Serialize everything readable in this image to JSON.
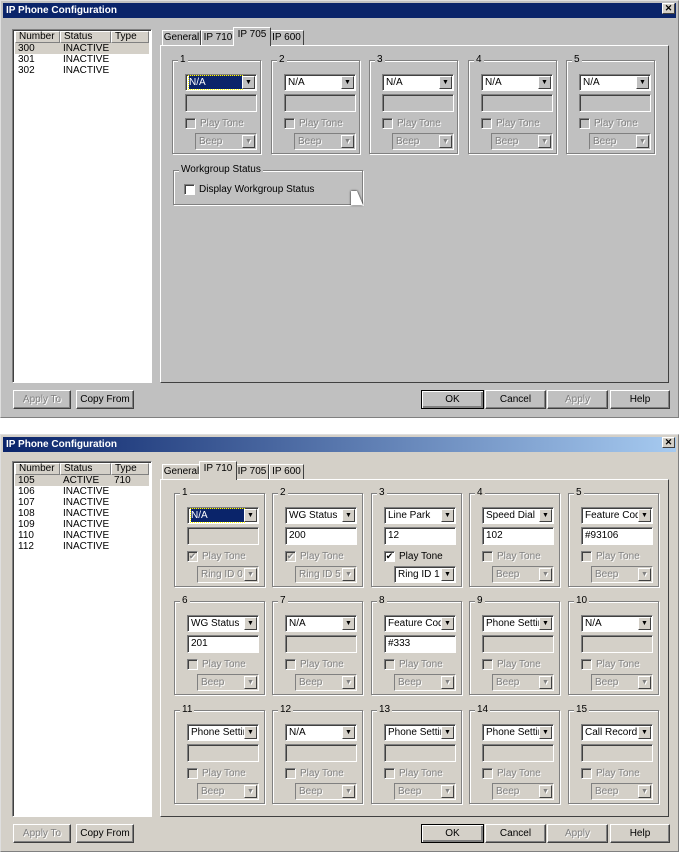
{
  "windows": [
    {
      "title": "IP Phone Configuration",
      "list_headers": [
        "Number",
        "Status",
        "Type"
      ],
      "rows": [
        [
          "300",
          "INACTIVE",
          ""
        ],
        [
          "301",
          "INACTIVE",
          ""
        ],
        [
          "302",
          "INACTIVE",
          ""
        ]
      ],
      "tabs": [
        "General",
        "IP 710",
        "IP 705",
        "IP 600"
      ],
      "active_tab": 2,
      "groups": [
        {
          "label": "1",
          "value": "N/A",
          "focused": true,
          "text": "",
          "text_enabled": false,
          "play_tone": false,
          "play_enabled": false,
          "ring": "Beep",
          "ring_enabled": false
        },
        {
          "label": "2",
          "value": "N/A",
          "text": "",
          "text_enabled": false,
          "play_tone": false,
          "play_enabled": false,
          "ring": "Beep",
          "ring_enabled": false
        },
        {
          "label": "3",
          "value": "N/A",
          "text": "",
          "text_enabled": false,
          "play_tone": false,
          "play_enabled": false,
          "ring": "Beep",
          "ring_enabled": false
        },
        {
          "label": "4",
          "value": "N/A",
          "text": "",
          "text_enabled": false,
          "play_tone": false,
          "play_enabled": false,
          "ring": "Beep",
          "ring_enabled": false
        },
        {
          "label": "5",
          "value": "N/A",
          "text": "",
          "text_enabled": false,
          "play_tone": false,
          "play_enabled": false,
          "ring": "Beep",
          "ring_enabled": false
        }
      ],
      "workgroup": {
        "label": "Workgroup Status",
        "checkbox": "Display Workgroup Status",
        "checked": false
      },
      "buttons": {
        "apply_to": "Apply To",
        "copy_from": "Copy From",
        "ok": "OK",
        "cancel": "Cancel",
        "apply": "Apply",
        "help": "Help"
      }
    },
    {
      "title": "IP Phone Configuration",
      "list_headers": [
        "Number",
        "Status",
        "Type"
      ],
      "rows": [
        [
          "105",
          "ACTIVE",
          "710"
        ],
        [
          "106",
          "INACTIVE",
          ""
        ],
        [
          "107",
          "INACTIVE",
          ""
        ],
        [
          "108",
          "INACTIVE",
          ""
        ],
        [
          "109",
          "INACTIVE",
          ""
        ],
        [
          "110",
          "INACTIVE",
          ""
        ],
        [
          "112",
          "INACTIVE",
          ""
        ]
      ],
      "tabs": [
        "General",
        "IP 710",
        "IP 705",
        "IP 600"
      ],
      "active_tab": 1,
      "groups": [
        {
          "label": "1",
          "value": "N/A",
          "focused": true,
          "text": "",
          "text_enabled": false,
          "play_tone": true,
          "play_enabled": false,
          "ring": "Ring ID 0",
          "ring_enabled": false
        },
        {
          "label": "2",
          "value": "WG Status",
          "text": "200",
          "text_enabled": true,
          "play_tone": true,
          "play_enabled": false,
          "ring": "Ring ID 5",
          "ring_enabled": false
        },
        {
          "label": "3",
          "value": "Line Park",
          "text": "12",
          "text_enabled": true,
          "play_tone": true,
          "play_enabled": true,
          "ring": "Ring ID 1",
          "ring_enabled": true
        },
        {
          "label": "4",
          "value": "Speed Dial",
          "text": "102",
          "text_enabled": true,
          "play_tone": false,
          "play_enabled": false,
          "ring": "Beep",
          "ring_enabled": false
        },
        {
          "label": "5",
          "value": "Feature Code",
          "text": "#93106",
          "text_enabled": true,
          "play_tone": false,
          "play_enabled": false,
          "ring": "Beep",
          "ring_enabled": false
        },
        {
          "label": "6",
          "value": "WG Status",
          "text": "201",
          "text_enabled": true,
          "play_tone": false,
          "play_enabled": false,
          "ring": "Beep",
          "ring_enabled": false
        },
        {
          "label": "7",
          "value": "N/A",
          "text": "",
          "text_enabled": false,
          "play_tone": false,
          "play_enabled": false,
          "ring": "Beep",
          "ring_enabled": false
        },
        {
          "label": "8",
          "value": "Feature Code",
          "text": "#333",
          "text_enabled": true,
          "play_tone": false,
          "play_enabled": false,
          "ring": "Beep",
          "ring_enabled": false
        },
        {
          "label": "9",
          "value": "Phone Setting",
          "text": "",
          "text_enabled": false,
          "play_tone": false,
          "play_enabled": false,
          "ring": "Beep",
          "ring_enabled": false
        },
        {
          "label": "10",
          "value": "N/A",
          "text": "",
          "text_enabled": false,
          "play_tone": false,
          "play_enabled": false,
          "ring": "Beep",
          "ring_enabled": false
        },
        {
          "label": "11",
          "value": "Phone Setting",
          "text": "",
          "text_enabled": false,
          "play_tone": false,
          "play_enabled": false,
          "ring": "Beep",
          "ring_enabled": false
        },
        {
          "label": "12",
          "value": "N/A",
          "text": "",
          "text_enabled": false,
          "play_tone": false,
          "play_enabled": false,
          "ring": "Beep",
          "ring_enabled": false
        },
        {
          "label": "13",
          "value": "Phone Setting",
          "text": "",
          "text_enabled": false,
          "play_tone": false,
          "play_enabled": false,
          "ring": "Beep",
          "ring_enabled": false
        },
        {
          "label": "14",
          "value": "Phone Setting",
          "text": "",
          "text_enabled": false,
          "play_tone": false,
          "play_enabled": false,
          "ring": "Beep",
          "ring_enabled": false
        },
        {
          "label": "15",
          "value": "Call Record",
          "text": "",
          "text_enabled": false,
          "play_tone": false,
          "play_enabled": false,
          "ring": "Beep",
          "ring_enabled": false
        }
      ],
      "buttons": {
        "apply_to": "Apply To",
        "copy_from": "Copy From",
        "ok": "OK",
        "cancel": "Cancel",
        "apply": "Apply",
        "help": "Help"
      }
    }
  ],
  "play_tone_label": "Play Tone",
  "icons": {
    "close": "close-icon",
    "dropdown": "chevron-down-icon",
    "check": "checkmark-icon",
    "cursor": "mouse-pointer-icon"
  }
}
